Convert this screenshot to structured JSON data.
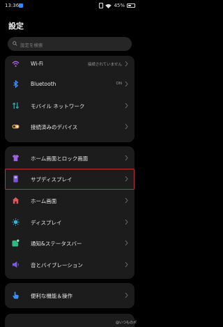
{
  "status": {
    "time": "13:36",
    "battery": "45%"
  },
  "page_title": "設定",
  "search": {
    "placeholder": "設定を検索"
  },
  "groups": [
    {
      "items": [
        {
          "label": "Wi-Fi",
          "value": "接続されていません",
          "icon": "wifi-icon"
        },
        {
          "label": "Bluetooth",
          "value": "ON",
          "icon": "bluetooth-icon"
        },
        {
          "label": "モバイル ネットワーク",
          "value": "",
          "icon": "mobile-network-icon"
        },
        {
          "label": "接続済みのデバイス",
          "value": "",
          "icon": "connected-devices-icon"
        }
      ]
    },
    {
      "items": [
        {
          "label": "ホーム画面とロック画面",
          "icon": "shirt-icon"
        },
        {
          "label": "サブディスプレイ",
          "icon": "sub-display-icon"
        },
        {
          "label": "ホーム画面",
          "icon": "home-icon"
        },
        {
          "label": "ディスプレイ",
          "icon": "sun-icon"
        },
        {
          "label": "通知&ステータスバー",
          "icon": "notification-icon"
        },
        {
          "label": "音とバイブレーション",
          "icon": "speaker-icon"
        }
      ]
    },
    {
      "items": [
        {
          "label": "便利な機能＆操作",
          "icon": "hand-pointer-icon"
        }
      ]
    }
  ],
  "watermark": "@いつものポ",
  "colors": {
    "background": "#000000",
    "card": "#1c1c1c",
    "highlight_border": "#c0323a",
    "accent_blue": "#2f8bff"
  }
}
